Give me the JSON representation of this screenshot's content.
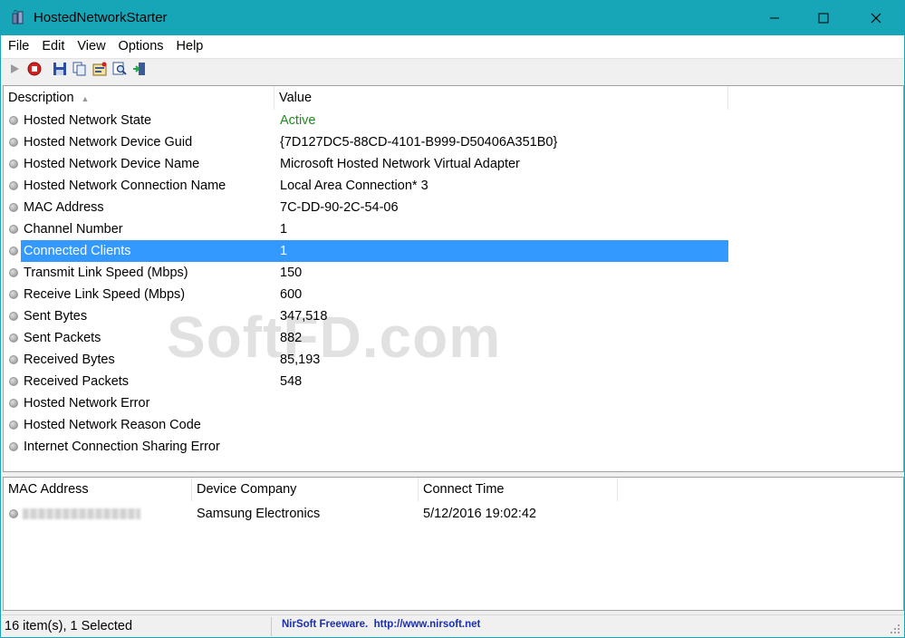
{
  "window": {
    "title": "HostedNetworkStarter"
  },
  "menu": [
    "File",
    "Edit",
    "View",
    "Options",
    "Help"
  ],
  "toolbar": [
    "start-icon",
    "stop-icon",
    "save-icon",
    "copy-icon",
    "properties-icon",
    "find-icon",
    "exit-icon"
  ],
  "upper": {
    "columns": [
      "Description",
      "Value"
    ],
    "rows": [
      {
        "desc": "Hosted Network State",
        "val": "Active"
      },
      {
        "desc": "Hosted Network Device Guid",
        "val": "{7D127DC5-88CD-4101-B999-D50406A351B0}"
      },
      {
        "desc": "Hosted Network Device Name",
        "val": "Microsoft Hosted Network Virtual Adapter"
      },
      {
        "desc": "Hosted Network Connection Name",
        "val": "Local Area Connection* 3"
      },
      {
        "desc": "MAC Address",
        "val": "7C-DD-90-2C-54-06"
      },
      {
        "desc": "Channel Number",
        "val": "1"
      },
      {
        "desc": "Connected Clients",
        "val": "1"
      },
      {
        "desc": "Transmit Link Speed (Mbps)",
        "val": "150"
      },
      {
        "desc": "Receive Link Speed (Mbps)",
        "val": "600"
      },
      {
        "desc": "Sent Bytes",
        "val": "347,518"
      },
      {
        "desc": "Sent Packets",
        "val": "882"
      },
      {
        "desc": "Received Bytes",
        "val": "85,193"
      },
      {
        "desc": "Received Packets",
        "val": "548"
      },
      {
        "desc": "Hosted Network Error",
        "val": ""
      },
      {
        "desc": "Hosted Network Reason Code",
        "val": ""
      },
      {
        "desc": "Internet Connection Sharing Error",
        "val": ""
      }
    ]
  },
  "lower": {
    "columns": [
      "MAC Address",
      "Device Company",
      "Connect Time"
    ],
    "row": {
      "company": "Samsung Electronics",
      "time": "5/12/2016 19:02:42"
    }
  },
  "status": {
    "items": "16 item(s), 1 Selected",
    "link": "NirSoft Freeware.  http://www.nirsoft.net"
  },
  "watermark": "SoftFD.com",
  "colors": {
    "titlebar": "#17a6b8",
    "selection": "#3399ff",
    "active_value": "#1e8a1e",
    "link": "#1b2fb0"
  }
}
